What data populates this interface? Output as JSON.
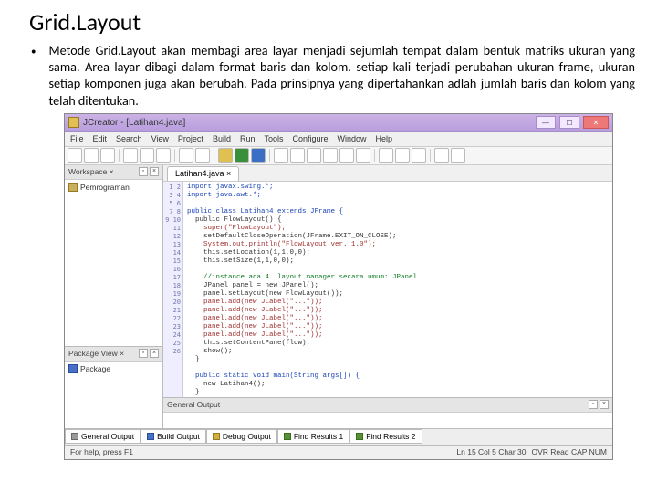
{
  "slide": {
    "title": "Grid.Layout",
    "bullet": "•",
    "body": "Metode Grid.Layout akan membagi area layar menjadi sejumlah tempat dalam bentuk matriks ukuran yang sama. Area layar dibagi dalam format baris dan kolom. setiap kali terjadi perubahan ukuran frame, ukuran setiap komponen juga akan berubah. Pada prinsipnya yang dipertahankan adlah jumlah baris dan kolom yang telah ditentukan."
  },
  "window": {
    "title": "JCreator - [Latihan4.java]",
    "min": "—",
    "max": "☐",
    "close": "✕"
  },
  "menu": [
    "File",
    "Edit",
    "Search",
    "View",
    "Project",
    "Build",
    "Run",
    "Tools",
    "Configure",
    "Window",
    "Help"
  ],
  "panes": {
    "workspace": "Workspace ×",
    "workspace_item": "Pemrograman",
    "package": "Package View ×",
    "package_item": "Package",
    "output_title": "General Output",
    "tab": "Latihan4.java ×"
  },
  "code": {
    "l1": "import javax.swing.*;",
    "l2": "import java.awt.*;",
    "l3": "",
    "l4": "public class Latihan4 extends JFrame {",
    "l5": "  public FlowLayout() {",
    "l6": "    super(\"FlowLayout\");",
    "l7": "    setDefaultCloseOperation(JFrame.EXIT_ON_CLOSE);",
    "l8": "    System.out.println(\"FlowLayout ver. 1.0\");",
    "l9": "    this.setLocation(1,1,0,0);",
    "l10": "    this.setSize(1,1,0,0);",
    "l11": "",
    "l12": "    //instance ada 4  layout manager secara umum: JPanel",
    "l13": "    JPanel panel = new JPanel();",
    "l14": "    panel.setLayout(new FlowLayout());",
    "l15": "    panel.add(new JLabel(\"...\"));",
    "l16": "    panel.add(new JLabel(\"...\"));",
    "l17": "    panel.add(new JLabel(\"...\"));",
    "l18": "    panel.add(new JLabel(\"...\"));",
    "l19": "    panel.add(new JLabel(\"...\"));",
    "l20": "    this.setContentPane(flow);",
    "l21": "    show();",
    "l22": "  }",
    "l23": "",
    "l24": "  public static void main(String args[]) {",
    "l25": "    new Latihan4();",
    "l26": "  }"
  },
  "bottom_tabs": [
    "General Output",
    "Build Output",
    "Debug Output",
    "Find Results 1",
    "Find Results 2"
  ],
  "status": {
    "help": "For help, press F1",
    "pos": "Ln 15  Col 5  Char 30",
    "modes": "OVR Read CAP NUM"
  }
}
